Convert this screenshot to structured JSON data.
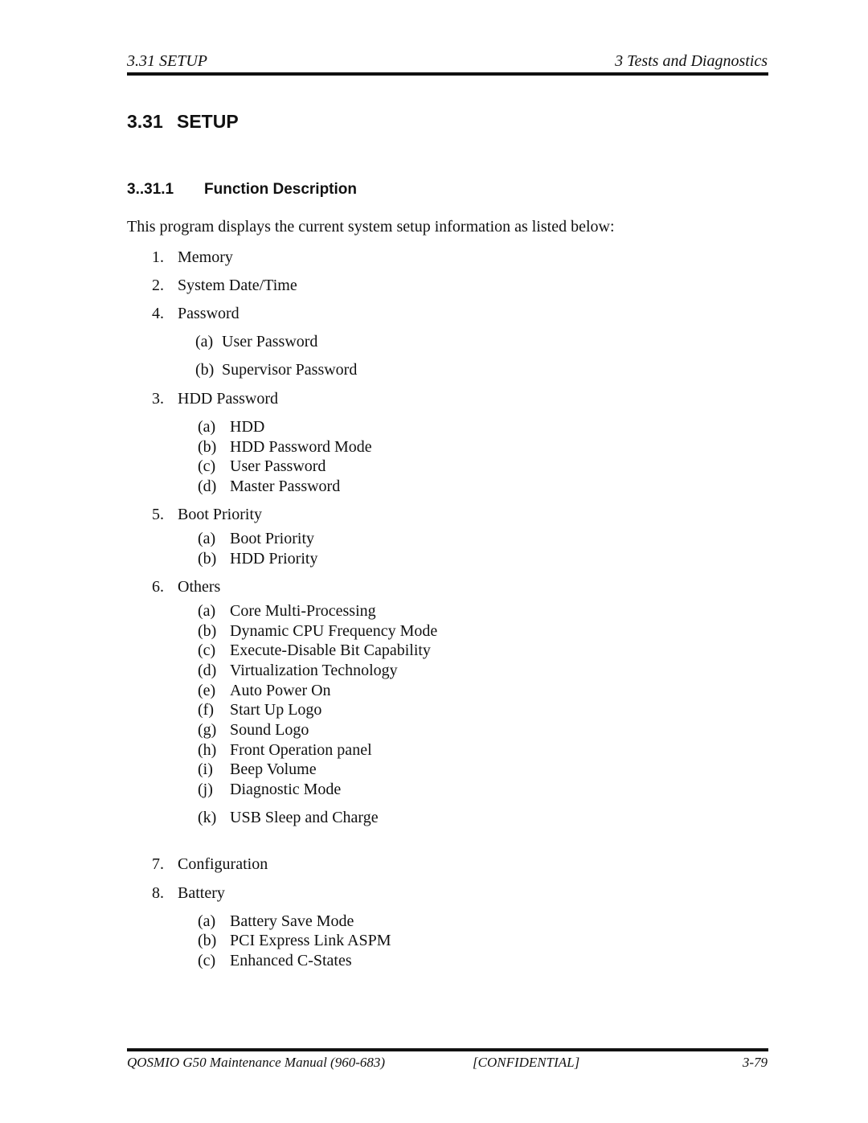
{
  "header": {
    "left": "3.31 SETUP",
    "right": "3 Tests and Diagnostics"
  },
  "section": {
    "number": "3.31",
    "title": "SETUP"
  },
  "subsection": {
    "number": "3..31.1",
    "title": "Function Description"
  },
  "intro": "This program displays the current system setup information as listed below:",
  "list": [
    {
      "marker": "1.",
      "label": "Memory",
      "items": []
    },
    {
      "marker": "2.",
      "label": "System Date/Time",
      "items": []
    },
    {
      "marker": "4.",
      "label": "Password",
      "items": [
        {
          "marker": "(a)",
          "label": "User Password"
        },
        {
          "marker": "(b)",
          "label": "Supervisor Password"
        }
      ]
    },
    {
      "marker": "3.",
      "label": "HDD Password",
      "items": [
        {
          "marker": "(a)",
          "label": "HDD"
        },
        {
          "marker": "(b)",
          "label": "HDD Password Mode"
        },
        {
          "marker": "(c)",
          "label": "User Password"
        },
        {
          "marker": "(d)",
          "label": "Master Password"
        }
      ]
    },
    {
      "marker": "5.",
      "label": "Boot Priority",
      "items": [
        {
          "marker": "(a)",
          "label": "Boot Priority"
        },
        {
          "marker": "(b)",
          "label": "HDD Priority"
        }
      ]
    },
    {
      "marker": "6.",
      "label": "Others",
      "items": [
        {
          "marker": "(a)",
          "label": "Core Multi-Processing"
        },
        {
          "marker": "(b)",
          "label": "Dynamic CPU Frequency Mode"
        },
        {
          "marker": "(c)",
          "label": "Execute-Disable Bit Capability"
        },
        {
          "marker": "(d)",
          "label": "Virtualization Technology"
        },
        {
          "marker": "(e)",
          "label": "Auto Power On"
        },
        {
          "marker": "(f)",
          "label": "Start Up Logo"
        },
        {
          "marker": "(g)",
          "label": "Sound Logo"
        },
        {
          "marker": "(h)",
          "label": "Front Operation panel"
        },
        {
          "marker": "(i)",
          "label": "Beep Volume"
        },
        {
          "marker": "(j)",
          "label": "Diagnostic Mode"
        },
        {
          "marker": "(k)",
          "label": "USB Sleep and Charge"
        }
      ]
    },
    {
      "marker": "7.",
      "label": "Configuration",
      "items": []
    },
    {
      "marker": "8.",
      "label": "Battery",
      "items": [
        {
          "marker": "(a)",
          "label": "Battery Save Mode"
        },
        {
          "marker": "(b)",
          "label": "PCI Express Link ASPM"
        },
        {
          "marker": "(c)",
          "label": "Enhanced C-States"
        }
      ]
    }
  ],
  "footer": {
    "left": "QOSMIO G50 Maintenance Manual (960-683)",
    "center": "[CONFIDENTIAL]",
    "right": "3-79"
  }
}
